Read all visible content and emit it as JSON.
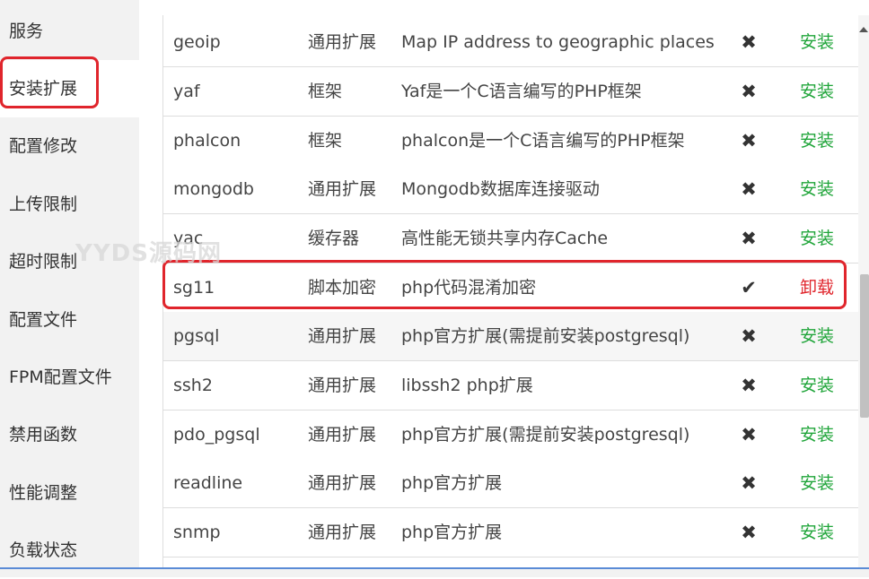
{
  "sidebar": {
    "items": [
      {
        "label": "服务"
      },
      {
        "label": "安装扩展"
      },
      {
        "label": "配置修改"
      },
      {
        "label": "上传限制"
      },
      {
        "label": "超时限制"
      },
      {
        "label": "配置文件"
      },
      {
        "label": "FPM配置文件"
      },
      {
        "label": "禁用函数"
      },
      {
        "label": "性能调整"
      },
      {
        "label": "负载状态"
      }
    ],
    "active_item": "安装扩展"
  },
  "extensions": [
    {
      "name": "geoip",
      "type": "通用扩展",
      "desc": "Map IP address to geographic places",
      "status": "✖",
      "op": "安装"
    },
    {
      "name": "yaf",
      "type": "框架",
      "desc": "Yaf是一个C语言编写的PHP框架",
      "status": "✖",
      "op": "安装"
    },
    {
      "name": "phalcon",
      "type": "框架",
      "desc": "phalcon是一个C语言编写的PHP框架",
      "status": "✖",
      "op": "安装"
    },
    {
      "name": "mongodb",
      "type": "通用扩展",
      "desc": "Mongodb数据库连接驱动",
      "status": "✖",
      "op": "安装"
    },
    {
      "name": "yac",
      "type": "缓存器",
      "desc": "高性能无锁共享内存Cache",
      "status": "✖",
      "op": "安装"
    },
    {
      "name": "sg11",
      "type": "脚本加密",
      "desc": "php代码混淆加密",
      "status": "✔",
      "op": "卸载"
    },
    {
      "name": "pgsql",
      "type": "通用扩展",
      "desc": "php官方扩展(需提前安装postgresql)",
      "status": "✖",
      "op": "安装"
    },
    {
      "name": "ssh2",
      "type": "通用扩展",
      "desc": "libssh2 php扩展",
      "status": "✖",
      "op": "安装"
    },
    {
      "name": "pdo_pgsql",
      "type": "通用扩展",
      "desc": "php官方扩展(需提前安装postgresql)",
      "status": "✖",
      "op": "安装"
    },
    {
      "name": "readline",
      "type": "通用扩展",
      "desc": "php官方扩展",
      "status": "✖",
      "op": "安装"
    },
    {
      "name": "snmp",
      "type": "通用扩展",
      "desc": "php官方扩展",
      "status": "✖",
      "op": "安装"
    }
  ],
  "watermark": "YYDS源码网",
  "colors": {
    "install": "#20a53a",
    "uninstall": "#e0252c",
    "highlight": "#e0252c",
    "sidebar_bg": "#f2f2f2"
  }
}
